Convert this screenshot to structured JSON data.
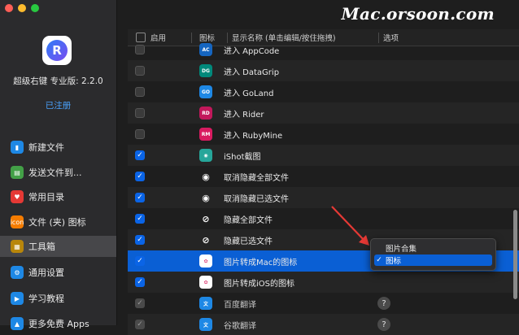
{
  "watermark": "Mac.orsoon.com",
  "sidebar": {
    "app_name": "超级右键 专业版: 2.2.0",
    "app_status": "已注册",
    "app_icon_letter": "R",
    "items": [
      {
        "label": "新建文件",
        "icon": "new-file-icon",
        "color": "#1e88e5",
        "glyph": "▮"
      },
      {
        "label": "发送文件到...",
        "icon": "send-file-icon",
        "color": "#43a047",
        "glyph": "▤"
      },
      {
        "label": "常用目录",
        "icon": "heart-icon",
        "color": "#e53935",
        "glyph": "♥"
      },
      {
        "label": "文件 (夹) 图标",
        "icon": "icon-badge-icon",
        "color": "#f57c00",
        "glyph": "icon"
      },
      {
        "label": "工具箱",
        "icon": "toolbox-icon",
        "color": "#b8860b",
        "glyph": "▦"
      },
      {
        "label": "通用设置",
        "icon": "gear-icon",
        "color": "#1e88e5",
        "glyph": "⚙"
      },
      {
        "label": "学习教程",
        "icon": "tutorial-icon",
        "color": "#1e88e5",
        "glyph": "▶"
      },
      {
        "label": "更多免费 Apps",
        "icon": "apps-icon",
        "color": "#1e88e5",
        "glyph": "▲"
      }
    ]
  },
  "table": {
    "headers": {
      "enable": "启用",
      "icon": "图标",
      "name": "显示名称 (单击编辑/按住拖拽)",
      "option": "选项"
    },
    "rows": [
      {
        "label": "进入 AppCode",
        "checked": false,
        "icon": "appcode-icon",
        "icon_text": "AC",
        "icon_color": "#1565c0"
      },
      {
        "label": "进入 DataGrip",
        "checked": false,
        "icon": "datagrip-icon",
        "icon_text": "DG",
        "icon_color": "#00897b"
      },
      {
        "label": "进入 GoLand",
        "checked": false,
        "icon": "goland-icon",
        "icon_text": "GO",
        "icon_color": "#1e88e5"
      },
      {
        "label": "进入 Rider",
        "checked": false,
        "icon": "rider-icon",
        "icon_text": "RD",
        "icon_color": "#c2185b"
      },
      {
        "label": "进入 RubyMine",
        "checked": false,
        "icon": "rubymine-icon",
        "icon_text": "RM",
        "icon_color": "#d81b60"
      },
      {
        "label": "iShot截图",
        "checked": true,
        "icon": "ishot-icon",
        "icon_text": "◉",
        "icon_color": "#26a69a"
      },
      {
        "label": "取消隐藏全部文件",
        "checked": true,
        "icon": "eye-icon",
        "icon_text": "◉",
        "icon_color": "#1e1e1e"
      },
      {
        "label": "取消隐藏已选文件",
        "checked": true,
        "icon": "eye-icon",
        "icon_text": "◉",
        "icon_color": "#1e1e1e"
      },
      {
        "label": "隐藏全部文件",
        "checked": true,
        "icon": "eye-slash-icon",
        "icon_text": "⊘",
        "icon_color": "#1e1e1e"
      },
      {
        "label": "隐藏已选文件",
        "checked": true,
        "icon": "eye-slash-icon",
        "icon_text": "⊘",
        "icon_color": "#1e1e1e"
      },
      {
        "label": "图片转成Mac的图标",
        "checked": true,
        "icon": "photos-icon",
        "icon_text": "✿",
        "icon_color": "#ffffff",
        "selected": true
      },
      {
        "label": "图片转成iOS的图标",
        "checked": true,
        "icon": "photos-icon",
        "icon_text": "✿",
        "icon_color": "#ffffff"
      },
      {
        "label": "百度翻译",
        "checked": true,
        "disabled": true,
        "icon": "translate-icon",
        "icon_text": "文",
        "icon_color": "#1e88e5",
        "help": "?"
      },
      {
        "label": "谷歌翻译",
        "checked": true,
        "disabled": true,
        "icon": "translate-icon",
        "icon_text": "文",
        "icon_color": "#1e88e5",
        "help": "?"
      }
    ]
  },
  "popup": {
    "options": [
      {
        "label": "图片合集",
        "selected": false
      },
      {
        "label": "图标",
        "selected": true
      }
    ],
    "check_glyph": "✓"
  }
}
